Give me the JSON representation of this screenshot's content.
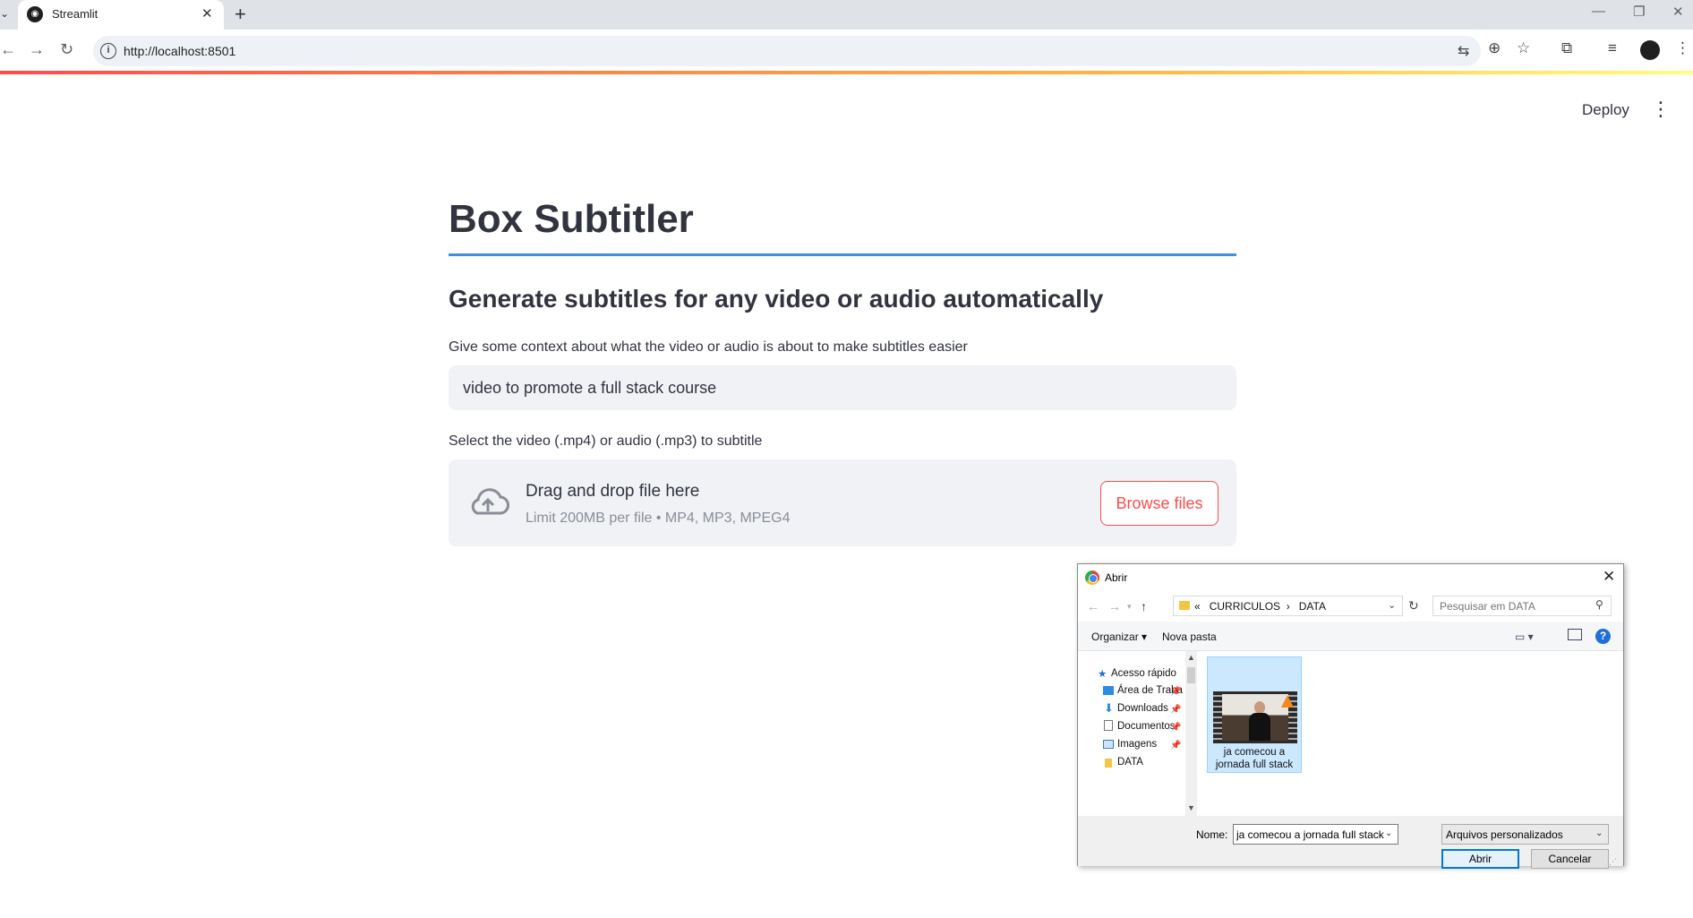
{
  "browser": {
    "tab_title": "Streamlit",
    "url": "http://localhost:8501"
  },
  "app": {
    "deploy_label": "Deploy",
    "title": "Box Subtitler",
    "subheader": "Generate subtitles for any video or audio automatically",
    "context_label": "Give some context about what the video or audio is about to make subtitles easier",
    "context_value": "video to promote a full stack course",
    "upload_label": "Select the video (.mp4) or audio (.mp3) to subtitle",
    "dropzone_title": "Drag and drop file here",
    "dropzone_limit": "Limit 200MB per file • MP4, MP3, MPEG4",
    "browse_label": "Browse files",
    "colors": {
      "accent": "#ff4b4b",
      "rule": "#3f8fe0",
      "text": "#31333f",
      "input_bg": "#f0f2f6"
    }
  },
  "dialog": {
    "title": "Abrir",
    "breadcrumb_prefix": "«",
    "breadcrumb": [
      "CURRICULOS",
      "DATA"
    ],
    "search_placeholder": "Pesquisar em DATA",
    "organize_label": "Organizar",
    "new_folder_label": "Nova pasta",
    "nav": {
      "quick_access": "Acesso rápido",
      "items": [
        "Área de Traba",
        "Downloads",
        "Documentos",
        "Imagens",
        "DATA"
      ]
    },
    "file": {
      "name": "ja comecou a jornada full stack"
    },
    "name_label": "Nome:",
    "name_value": "ja comecou a jornada full stack",
    "file_type": "Arquivos personalizados",
    "open_label": "Abrir",
    "cancel_label": "Cancelar"
  }
}
